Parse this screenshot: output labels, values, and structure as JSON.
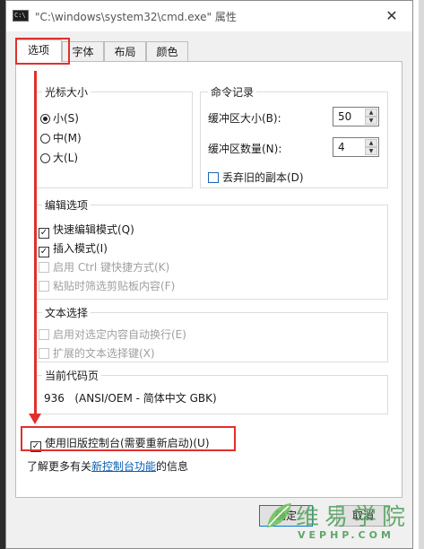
{
  "window": {
    "title": "\"C:\\windows\\system32\\cmd.exe\" 属性",
    "close_glyph": "✕",
    "icon_text": "C:\\"
  },
  "tabs": [
    {
      "label": "选项"
    },
    {
      "label": "字体"
    },
    {
      "label": "布局"
    },
    {
      "label": "颜色"
    }
  ],
  "cursor_size": {
    "title": "光标大小",
    "options": [
      {
        "label": "小(S)",
        "selected": true
      },
      {
        "label": "中(M)",
        "selected": false
      },
      {
        "label": "大(L)",
        "selected": false
      }
    ]
  },
  "command_history": {
    "title": "命令记录",
    "buffer_size_label": "缓冲区大小(B):",
    "buffer_size_value": "50",
    "buffer_count_label": "缓冲区数量(N):",
    "buffer_count_value": "4",
    "discard_label": "丢弃旧的副本(D)"
  },
  "edit_options": {
    "title": "编辑选项",
    "items": [
      {
        "label": "快速编辑模式(Q)"
      },
      {
        "label": "插入模式(I)"
      },
      {
        "label": "启用 Ctrl 键快捷方式(K)"
      },
      {
        "label": "粘贴时筛选剪贴板内容(F)"
      }
    ]
  },
  "text_selection": {
    "title": "文本选择",
    "items": [
      {
        "label": "启用对选定内容自动换行(E)"
      },
      {
        "label": "扩展的文本选择键(X)"
      }
    ]
  },
  "codepage": {
    "title": "当前代码页",
    "value": "936   (ANSI/OEM - 简体中文 GBK)"
  },
  "legacy": {
    "label": "使用旧版控制台(需要重新启动)(U)",
    "checked": true
  },
  "learn_more": {
    "prefix": "了解更多有关",
    "link": "新控制台功能",
    "suffix": "的信息"
  },
  "buttons": {
    "ok": "确定",
    "cancel": "取消"
  },
  "watermark": {
    "cn": "维易学院",
    "en": "VEPHP.COM"
  },
  "colors": {
    "annotation_red": "#e0302c",
    "link_blue": "#0a5fb4",
    "watermark_green": "#4fa05a"
  }
}
